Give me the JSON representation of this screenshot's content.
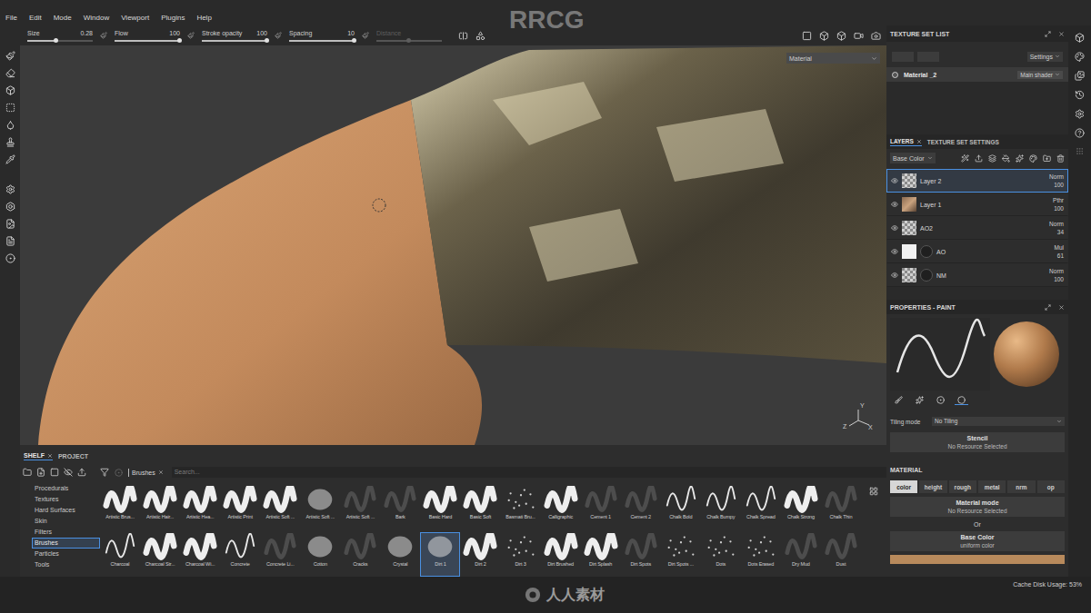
{
  "watermark": {
    "top": "RRCG",
    "bottom": "人人素材"
  },
  "menu": [
    "File",
    "Edit",
    "Mode",
    "Window",
    "Viewport",
    "Plugins",
    "Help"
  ],
  "tool_options": [
    {
      "label": "Size",
      "value": "0.28",
      "level": 0.45,
      "disabled": false
    },
    {
      "label": "Flow",
      "value": "100",
      "level": 1,
      "disabled": false
    },
    {
      "label": "Stroke opacity",
      "value": "100",
      "level": 1,
      "disabled": false
    },
    {
      "label": "Spacing",
      "value": "10",
      "level": 1,
      "disabled": false
    },
    {
      "label": "Distance",
      "level": 0.5,
      "disabled": true
    }
  ],
  "viewport": {
    "material_dropdown": "Material",
    "axes": [
      "Y",
      "Z",
      "X"
    ]
  },
  "texture_set_list": {
    "title": "TEXTURE SET LIST",
    "settings": "Settings",
    "sets": [
      {
        "name": "Material _2",
        "shader": "Main shader",
        "selected": true
      }
    ]
  },
  "layers": {
    "tabs": [
      {
        "label": "LAYERS",
        "selected": true
      },
      {
        "label": "TEXTURE SET SETTINGS",
        "selected": false
      }
    ],
    "channel": "Base Color",
    "items": [
      {
        "name": "Layer 2",
        "blend": "Norm",
        "opacity": "100",
        "selected": true,
        "visible": true,
        "kind": "checker",
        "mask": false
      },
      {
        "name": "Layer 1",
        "blend": "Pthr",
        "opacity": "100",
        "selected": false,
        "visible": true,
        "kind": "image",
        "mask": false
      },
      {
        "name": "AO2",
        "blend": "Norm",
        "opacity": "34",
        "selected": false,
        "visible": true,
        "kind": "checker",
        "mask": false
      },
      {
        "name": "AO",
        "blend": "Mul",
        "opacity": "61",
        "selected": false,
        "visible": true,
        "kind": "white",
        "mask": true
      },
      {
        "name": "NM",
        "blend": "Norm",
        "opacity": "100",
        "selected": false,
        "visible": true,
        "kind": "checker",
        "mask": true
      }
    ]
  },
  "properties": {
    "title": "PROPERTIES - PAINT",
    "icon_tabs": [
      {
        "selected": false
      },
      {
        "selected": false
      },
      {
        "selected": false
      },
      {
        "selected": true
      }
    ],
    "tiling_label": "Tiling mode",
    "tiling_value": "No Tiling",
    "stencil_title": "Stencil",
    "stencil_value": "No Resource Selected",
    "material_title": "MATERIAL",
    "channels": [
      {
        "label": "color",
        "selected": true
      },
      {
        "label": "height",
        "selected": false
      },
      {
        "label": "rough",
        "selected": false
      },
      {
        "label": "metal",
        "selected": false
      },
      {
        "label": "nrm",
        "selected": false
      },
      {
        "label": "op",
        "selected": false
      }
    ],
    "mode_title": "Material mode",
    "mode_value": "No Resource Selected",
    "or": "Or",
    "base_title": "Base Color",
    "base_value": "uniform color",
    "swatch": "#b88a5c"
  },
  "shelf": {
    "tabs": [
      {
        "label": "SHELF",
        "selected": true
      },
      {
        "label": "PROJECT",
        "selected": false
      }
    ],
    "categories": [
      {
        "label": "Procedurals",
        "selected": false
      },
      {
        "label": "Textures",
        "selected": false
      },
      {
        "label": "Hard Surfaces",
        "selected": false
      },
      {
        "label": "Skin",
        "selected": false
      },
      {
        "label": "Filters",
        "selected": false
      },
      {
        "label": "Brushes",
        "selected": true
      },
      {
        "label": "Particles",
        "selected": false
      },
      {
        "label": "Tools",
        "selected": false
      }
    ],
    "filter": "Brushes",
    "search_placeholder": "Search...",
    "brushes": [
      {
        "name": "Artistic Brus...",
        "kind": "stroke",
        "selected": false
      },
      {
        "name": "Artistic Hair...",
        "kind": "stroke",
        "selected": false
      },
      {
        "name": "Artistic Hea...",
        "kind": "stroke",
        "selected": false
      },
      {
        "name": "Artistic Print",
        "kind": "stroke",
        "selected": false
      },
      {
        "name": "Artistic Soft ...",
        "kind": "stroke",
        "selected": false
      },
      {
        "name": "Artistic Soft ...",
        "kind": "soft",
        "selected": false
      },
      {
        "name": "Artistic Soft ...",
        "kind": "faint",
        "selected": false
      },
      {
        "name": "Bark",
        "kind": "faint",
        "selected": false
      },
      {
        "name": "Basic Hard",
        "kind": "stroke",
        "selected": false
      },
      {
        "name": "Basic Soft",
        "kind": "stroke",
        "selected": false
      },
      {
        "name": "Basmati Bru...",
        "kind": "speckle",
        "selected": false
      },
      {
        "name": "Calligraphic",
        "kind": "stroke",
        "selected": false
      },
      {
        "name": "Cement 1",
        "kind": "faint",
        "selected": false
      },
      {
        "name": "Cement 2",
        "kind": "faint",
        "selected": false
      },
      {
        "name": "Chalk Bold",
        "kind": "line",
        "selected": false
      },
      {
        "name": "Chalk Bumpy",
        "kind": "line",
        "selected": false
      },
      {
        "name": "Chalk Spread",
        "kind": "line",
        "selected": false
      },
      {
        "name": "Chalk Strong",
        "kind": "stroke",
        "selected": false
      },
      {
        "name": "Chalk Thin",
        "kind": "faint",
        "selected": false
      },
      {
        "name": "Charcoal",
        "kind": "line",
        "selected": false
      },
      {
        "name": "Charcoal Str...",
        "kind": "stroke",
        "selected": false
      },
      {
        "name": "Charcoal Wi...",
        "kind": "stroke",
        "selected": false
      },
      {
        "name": "Concrete",
        "kind": "line",
        "selected": false
      },
      {
        "name": "Concrete Li...",
        "kind": "faint",
        "selected": false
      },
      {
        "name": "Cotton",
        "kind": "soft",
        "selected": false
      },
      {
        "name": "Cracks",
        "kind": "faint",
        "selected": false
      },
      {
        "name": "Crystal",
        "kind": "soft",
        "selected": false
      },
      {
        "name": "Dirt 1",
        "kind": "soft",
        "selected": true
      },
      {
        "name": "Dirt 2",
        "kind": "stroke",
        "selected": false
      },
      {
        "name": "Dirt 3",
        "kind": "speckle",
        "selected": false
      },
      {
        "name": "Dirt Brushed",
        "kind": "stroke",
        "selected": false
      },
      {
        "name": "Dirt Splash",
        "kind": "stroke",
        "selected": false
      },
      {
        "name": "Dirt Spots",
        "kind": "faint",
        "selected": false
      },
      {
        "name": "Dirt Spots ...",
        "kind": "speckle",
        "selected": false
      },
      {
        "name": "Dots",
        "kind": "speckle",
        "selected": false
      },
      {
        "name": "Dots Erased",
        "kind": "speckle",
        "selected": false
      },
      {
        "name": "Dry Mud",
        "kind": "faint",
        "selected": false
      },
      {
        "name": "Dust",
        "kind": "faint",
        "selected": false
      }
    ]
  },
  "status_bar": {
    "cache": "Cache Disk Usage: 53%"
  }
}
